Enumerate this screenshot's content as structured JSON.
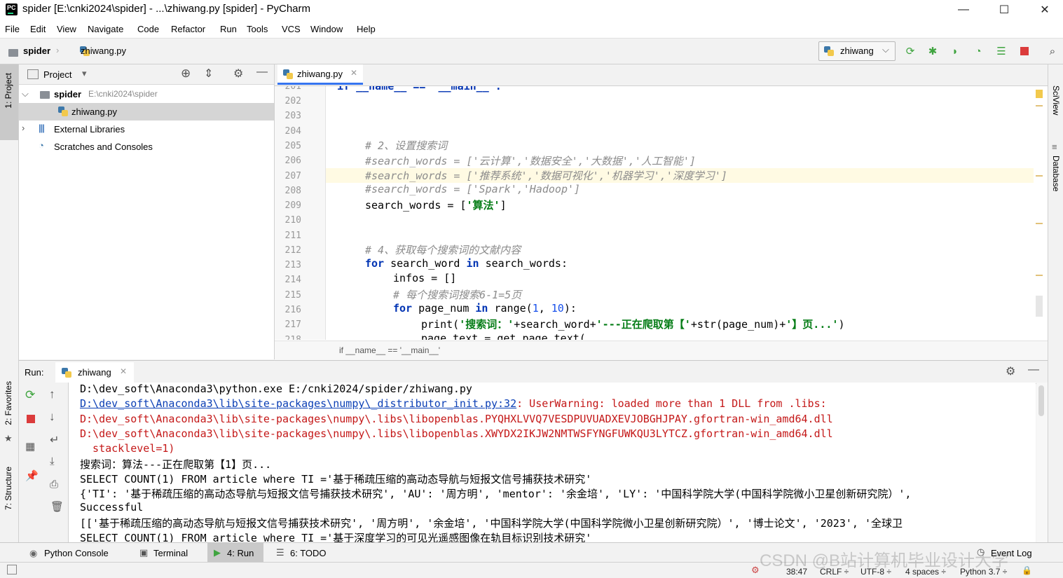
{
  "window": {
    "title": "spider [E:\\cnki2024\\spider] - ...\\zhiwang.py [spider] - PyCharm",
    "minimize": "—",
    "maximize": "☐",
    "close": "✕"
  },
  "menu": [
    "File",
    "Edit",
    "View",
    "Navigate",
    "Code",
    "Refactor",
    "Run",
    "Tools",
    "VCS",
    "Window",
    "Help"
  ],
  "nav": {
    "project": "spider",
    "file": "zhiwang.py",
    "run_config": "zhiwang"
  },
  "colors": {
    "accent": "#3574f0",
    "run_green": "#3fa43f",
    "stop_red": "#db3b3b",
    "selection": "#d5d5d5"
  },
  "project_panel": {
    "title": "Project",
    "tree": [
      {
        "label": "spider",
        "path": "E:\\cnki2024\\spider"
      },
      {
        "label": "zhiwang.py"
      },
      {
        "label": "External Libraries"
      },
      {
        "label": "Scratches and Consoles"
      }
    ]
  },
  "editor": {
    "tab": "zhiwang.py",
    "line_numbers": [
      "201",
      "202",
      "203",
      "204",
      "205",
      "206",
      "207",
      "208",
      "209",
      "210",
      "211",
      "212",
      "213",
      "214",
      "215",
      "216",
      "217",
      "218"
    ],
    "lines": {
      "l201": "if __name__ == '__main__':",
      "l205": "# 2、设置搜索词",
      "l206": "#search_words = ['云计算','数据安全','大数据','人工智能']",
      "l207": "#search_words = ['推荐系统','数据可视化','机器学习','深度学习']",
      "l208": "#search_words = ['Spark','Hadoop']",
      "l209a": "search_words = [",
      "l209b": "'算法'",
      "l209c": "]",
      "l212": "# 4、获取每个搜索词的文献内容",
      "l213a": "for",
      "l213b": " search_word ",
      "l213c": "in",
      "l213d": " search_words:",
      "l214": "infos = []",
      "l215": "# 每个搜索词搜索6-1=5页",
      "l216a": "for",
      "l216b": " page_num ",
      "l216c": "in",
      "l216d": " range(",
      "l216e": "1",
      "l216f": ", ",
      "l216g": "10",
      "l216h": "):",
      "l217a": "print(",
      "l217b": "'搜索词：'",
      "l217c": "+search_word+",
      "l217d": "'---正在爬取第【'",
      "l217e": "+str(page_num)+",
      "l217f": "'】页...'",
      "l217g": ")",
      "l218": "page_text = get_page_text("
    },
    "breadcrumb": "if __name__ == '__main__'"
  },
  "run_panel": {
    "label": "Run:",
    "tab": "zhiwang",
    "output": {
      "o1": "D:\\dev_soft\\Anaconda3\\python.exe E:/cnki2024/spider/zhiwang.py",
      "o2a": "D:\\dev_soft\\Anaconda3\\lib\\site-packages\\numpy\\_distributor_init.py:32",
      "o2b": ": UserWarning: loaded more than 1 DLL from .libs:",
      "o3": "D:\\dev_soft\\Anaconda3\\lib\\site-packages\\numpy\\.libs\\libopenblas.PYQHXLVVQ7VESDPUVUADXEVJOBGHJPAY.gfortran-win_amd64.dll",
      "o4": "D:\\dev_soft\\Anaconda3\\lib\\site-packages\\numpy\\.libs\\libopenblas.XWYDX2IKJW2NMTWSFYNGFUWKQU3LYTCZ.gfortran-win_amd64.dll",
      "o5": "  stacklevel=1)",
      "o6": "搜索词：算法---正在爬取第【1】页...",
      "o7": "SELECT COUNT(1) FROM article where TI ='基于稀疏压缩的高动态导航与短报文信号捕获技术研究'",
      "o8": "{'TI': '基于稀疏压缩的高动态导航与短报文信号捕获技术研究', 'AU': '周方明', 'mentor': '余金培', 'LY': '中国科学院大学(中国科学院微小卫星创新研究院）',",
      "o9": "Successful",
      "o10": "[['基于稀疏压缩的高动态导航与短报文信号捕获技术研究', '周方明', '余金培', '中国科学院大学(中国科学院微小卫星创新研究院）', '博士论文', '2023', '全球卫",
      "o11": "SELECT COUNT(1) FROM article where TI ='基于深度学习的可见光遥感图像在轨目标识别技术研究'"
    }
  },
  "left_tabs": {
    "project": "1: Project",
    "favorites": "2: Favorites",
    "structure": "7: Structure"
  },
  "right_tabs": {
    "sciview": "SciView",
    "database": "Database"
  },
  "bottom_tabs": [
    "Python Console",
    "Terminal",
    "4: Run",
    "6: TODO"
  ],
  "event_log": "Event Log",
  "status": {
    "position": "38:47",
    "line_sep": "CRLF ÷",
    "encoding": "UTF-8 ÷",
    "indent": "4 spaces ÷",
    "interpreter": "Python 3.7 ÷"
  },
  "watermark": "CSDN @B站计算机毕业设计大学"
}
